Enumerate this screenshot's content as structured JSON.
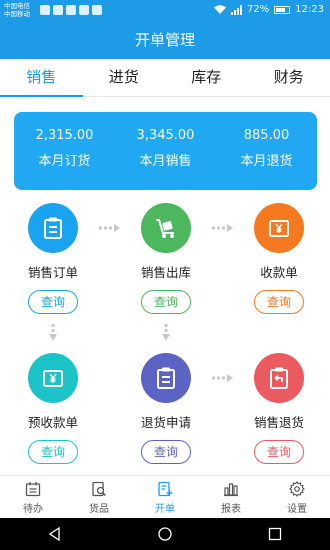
{
  "status_bar": {
    "carrier_1": "中国电信",
    "carrier_2": "中国移动",
    "battery": "72%",
    "time": "12:23"
  },
  "title": "开单管理",
  "tabs": [
    {
      "label": "销售",
      "active": true
    },
    {
      "label": "进货",
      "active": false
    },
    {
      "label": "库存",
      "active": false
    },
    {
      "label": "财务",
      "active": false
    }
  ],
  "stats": [
    {
      "value": "2,315.00",
      "label": "本月订货"
    },
    {
      "value": "3,345.00",
      "label": "本月销售"
    },
    {
      "value": "885.00",
      "label": "本月退货"
    }
  ],
  "nodes": [
    {
      "label": "销售订单",
      "button": "查询",
      "icon": "clipboard-icon",
      "color": "#1aa3ee"
    },
    {
      "label": "销售出库",
      "button": "查询",
      "icon": "delivery-cart-icon",
      "color": "#4cb75c"
    },
    {
      "label": "收款单",
      "button": "查询",
      "icon": "yen-receipt-icon",
      "color": "#f4791f"
    },
    {
      "label": "预收款单",
      "button": "查询",
      "icon": "yen-receipt-icon",
      "color": "#1cc3c9"
    },
    {
      "label": "退货申请",
      "button": "查询",
      "icon": "clipboard-icon",
      "color": "#5b64c4"
    },
    {
      "label": "销售退货",
      "button": "查询",
      "icon": "return-icon",
      "color": "#ea5a5e"
    }
  ],
  "bottom_nav": [
    {
      "label": "待办",
      "icon": "calendar-icon",
      "active": false
    },
    {
      "label": "货品",
      "icon": "goods-search-icon",
      "active": false
    },
    {
      "label": "开单",
      "icon": "create-order-icon",
      "active": true
    },
    {
      "label": "报表",
      "icon": "bar-chart-icon",
      "active": false
    },
    {
      "label": "设置",
      "icon": "gear-icon",
      "active": false
    }
  ],
  "colors": {
    "primary": "#1e9be6",
    "card": "#21a8f3",
    "arrow": "#c8c8c8"
  }
}
